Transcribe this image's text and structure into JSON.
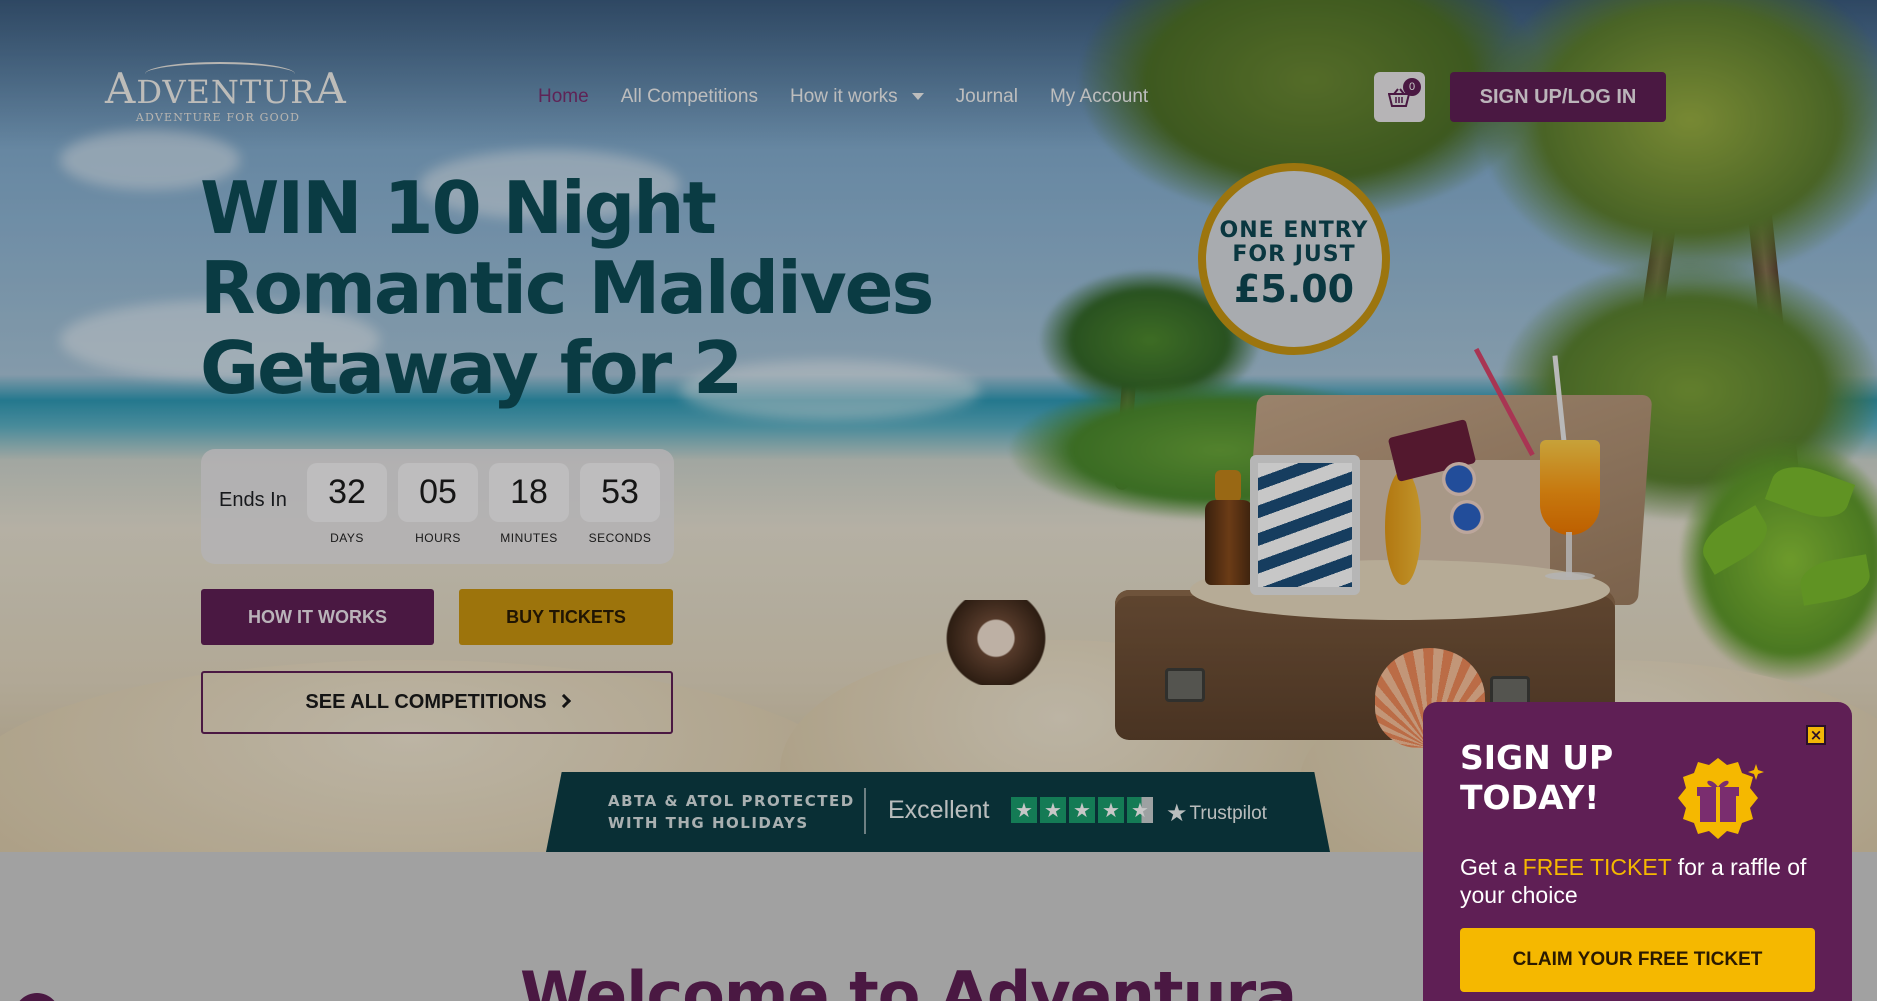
{
  "brand": {
    "logo_word_first": "A",
    "logo_word_mid": "DVENTUR",
    "logo_word_last": "A",
    "tagline": "ADVENTURE FOR GOOD",
    "primary_color": "#5f1f55",
    "accent_color": "#f5b800",
    "teal_color": "#0d4c56"
  },
  "nav": {
    "items": [
      {
        "label": "Home",
        "active": true
      },
      {
        "label": "All Competitions"
      },
      {
        "label": "How it works",
        "has_dropdown": true
      },
      {
        "label": "Journal"
      },
      {
        "label": "My Account"
      }
    ]
  },
  "header": {
    "cart_count": "0",
    "cart_icon": "basket-icon",
    "signup_label": "SIGN UP/LOG IN"
  },
  "hero": {
    "title": "WIN 10 Night Romantic Maldives Getaway for 2",
    "price_badge": {
      "line1": "ONE ENTRY",
      "line2": "FOR JUST",
      "amount": "£5.00"
    },
    "countdown": {
      "label": "Ends In",
      "units": [
        {
          "value": "32",
          "label": "DAYS"
        },
        {
          "value": "05",
          "label": "HOURS"
        },
        {
          "value": "18",
          "label": "MINUTES"
        },
        {
          "value": "53",
          "label": "SECONDS"
        }
      ]
    },
    "buttons": {
      "how_it_works": "HOW IT WORKS",
      "buy_tickets": "BUY TICKETS",
      "see_all": "SEE ALL COMPETITIONS"
    }
  },
  "trust_bar": {
    "abta_line1": "ABTA & ATOL PROTECTED",
    "abta_line2": "WITH THG HOLIDAYS",
    "rating_text": "Excellent",
    "stars": 4.5,
    "provider": "Trustpilot"
  },
  "lower": {
    "welcome_heading": "Welcome to Adventura"
  },
  "signup_modal": {
    "close_icon": "close-icon",
    "title_line1": "SIGN UP",
    "title_line2": "TODAY!",
    "gift_icon": "gift-icon",
    "text_before": "Get a ",
    "text_highlight": "FREE TICKET",
    "text_after": " for a raffle of your choice",
    "button_label": "CLAIM YOUR FREE TICKET"
  }
}
